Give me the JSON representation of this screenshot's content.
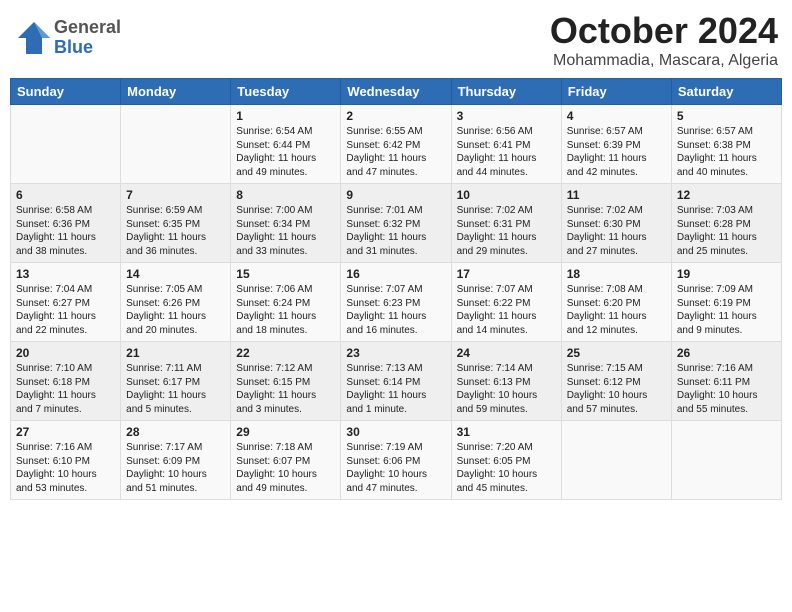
{
  "logo": {
    "general": "General",
    "blue": "Blue"
  },
  "title": "October 2024",
  "subtitle": "Mohammadia, Mascara, Algeria",
  "weekdays": [
    "Sunday",
    "Monday",
    "Tuesday",
    "Wednesday",
    "Thursday",
    "Friday",
    "Saturday"
  ],
  "weeks": [
    [
      {
        "day": "",
        "info": ""
      },
      {
        "day": "",
        "info": ""
      },
      {
        "day": "1",
        "info": "Sunrise: 6:54 AM\nSunset: 6:44 PM\nDaylight: 11 hours and 49 minutes."
      },
      {
        "day": "2",
        "info": "Sunrise: 6:55 AM\nSunset: 6:42 PM\nDaylight: 11 hours and 47 minutes."
      },
      {
        "day": "3",
        "info": "Sunrise: 6:56 AM\nSunset: 6:41 PM\nDaylight: 11 hours and 44 minutes."
      },
      {
        "day": "4",
        "info": "Sunrise: 6:57 AM\nSunset: 6:39 PM\nDaylight: 11 hours and 42 minutes."
      },
      {
        "day": "5",
        "info": "Sunrise: 6:57 AM\nSunset: 6:38 PM\nDaylight: 11 hours and 40 minutes."
      }
    ],
    [
      {
        "day": "6",
        "info": "Sunrise: 6:58 AM\nSunset: 6:36 PM\nDaylight: 11 hours and 38 minutes."
      },
      {
        "day": "7",
        "info": "Sunrise: 6:59 AM\nSunset: 6:35 PM\nDaylight: 11 hours and 36 minutes."
      },
      {
        "day": "8",
        "info": "Sunrise: 7:00 AM\nSunset: 6:34 PM\nDaylight: 11 hours and 33 minutes."
      },
      {
        "day": "9",
        "info": "Sunrise: 7:01 AM\nSunset: 6:32 PM\nDaylight: 11 hours and 31 minutes."
      },
      {
        "day": "10",
        "info": "Sunrise: 7:02 AM\nSunset: 6:31 PM\nDaylight: 11 hours and 29 minutes."
      },
      {
        "day": "11",
        "info": "Sunrise: 7:02 AM\nSunset: 6:30 PM\nDaylight: 11 hours and 27 minutes."
      },
      {
        "day": "12",
        "info": "Sunrise: 7:03 AM\nSunset: 6:28 PM\nDaylight: 11 hours and 25 minutes."
      }
    ],
    [
      {
        "day": "13",
        "info": "Sunrise: 7:04 AM\nSunset: 6:27 PM\nDaylight: 11 hours and 22 minutes."
      },
      {
        "day": "14",
        "info": "Sunrise: 7:05 AM\nSunset: 6:26 PM\nDaylight: 11 hours and 20 minutes."
      },
      {
        "day": "15",
        "info": "Sunrise: 7:06 AM\nSunset: 6:24 PM\nDaylight: 11 hours and 18 minutes."
      },
      {
        "day": "16",
        "info": "Sunrise: 7:07 AM\nSunset: 6:23 PM\nDaylight: 11 hours and 16 minutes."
      },
      {
        "day": "17",
        "info": "Sunrise: 7:07 AM\nSunset: 6:22 PM\nDaylight: 11 hours and 14 minutes."
      },
      {
        "day": "18",
        "info": "Sunrise: 7:08 AM\nSunset: 6:20 PM\nDaylight: 11 hours and 12 minutes."
      },
      {
        "day": "19",
        "info": "Sunrise: 7:09 AM\nSunset: 6:19 PM\nDaylight: 11 hours and 9 minutes."
      }
    ],
    [
      {
        "day": "20",
        "info": "Sunrise: 7:10 AM\nSunset: 6:18 PM\nDaylight: 11 hours and 7 minutes."
      },
      {
        "day": "21",
        "info": "Sunrise: 7:11 AM\nSunset: 6:17 PM\nDaylight: 11 hours and 5 minutes."
      },
      {
        "day": "22",
        "info": "Sunrise: 7:12 AM\nSunset: 6:15 PM\nDaylight: 11 hours and 3 minutes."
      },
      {
        "day": "23",
        "info": "Sunrise: 7:13 AM\nSunset: 6:14 PM\nDaylight: 11 hours and 1 minute."
      },
      {
        "day": "24",
        "info": "Sunrise: 7:14 AM\nSunset: 6:13 PM\nDaylight: 10 hours and 59 minutes."
      },
      {
        "day": "25",
        "info": "Sunrise: 7:15 AM\nSunset: 6:12 PM\nDaylight: 10 hours and 57 minutes."
      },
      {
        "day": "26",
        "info": "Sunrise: 7:16 AM\nSunset: 6:11 PM\nDaylight: 10 hours and 55 minutes."
      }
    ],
    [
      {
        "day": "27",
        "info": "Sunrise: 7:16 AM\nSunset: 6:10 PM\nDaylight: 10 hours and 53 minutes."
      },
      {
        "day": "28",
        "info": "Sunrise: 7:17 AM\nSunset: 6:09 PM\nDaylight: 10 hours and 51 minutes."
      },
      {
        "day": "29",
        "info": "Sunrise: 7:18 AM\nSunset: 6:07 PM\nDaylight: 10 hours and 49 minutes."
      },
      {
        "day": "30",
        "info": "Sunrise: 7:19 AM\nSunset: 6:06 PM\nDaylight: 10 hours and 47 minutes."
      },
      {
        "day": "31",
        "info": "Sunrise: 7:20 AM\nSunset: 6:05 PM\nDaylight: 10 hours and 45 minutes."
      },
      {
        "day": "",
        "info": ""
      },
      {
        "day": "",
        "info": ""
      }
    ]
  ]
}
